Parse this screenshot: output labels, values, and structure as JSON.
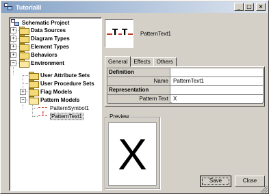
{
  "window": {
    "title": "TutorialII",
    "minimize": "_",
    "maximize": "□",
    "close": "×"
  },
  "tree": {
    "root": "Schematic Project",
    "data_sources": "Data Sources",
    "diagram_types": "Diagram Types",
    "element_types": "Element Types",
    "behaviors": "Behaviors",
    "environment": "Environment",
    "user_attribute_sets": "User Attribute Sets",
    "user_procedure_sets": "User Procedure Sets",
    "flag_models": "Flag Models",
    "pattern_models": "Pattern Models",
    "pattern_symbol": "PatternSymbol1",
    "pattern_text": "PatternText1",
    "expand": "+",
    "collapse": "−"
  },
  "header": {
    "name": "PatternText1",
    "icon_glyph": "T"
  },
  "tabs": {
    "general": "General",
    "effects": "Effects",
    "others": "Others"
  },
  "properties": {
    "definition": "Definition",
    "name_label": "Name",
    "name_value": "PatternText1",
    "representation": "Representation",
    "pattern_text_label": "Pattern Text",
    "pattern_text_value": "X"
  },
  "preview": {
    "label": "Preview",
    "text": "X"
  },
  "buttons": {
    "save": "Save",
    "close": "Close"
  }
}
